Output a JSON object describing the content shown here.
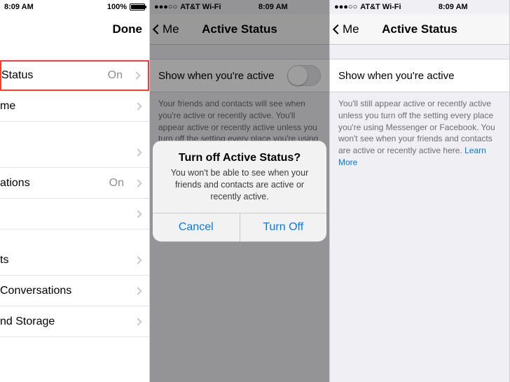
{
  "status": {
    "time": "8:09 AM",
    "carrier": "AT&T Wi-Fi",
    "battery_pct": "100%"
  },
  "panel1": {
    "done": "Done",
    "rows": [
      {
        "label": "Status",
        "value": "On"
      },
      {
        "label": "me",
        "value": ""
      },
      {
        "label": "",
        "value": ""
      },
      {
        "label": "ations",
        "value": "On"
      },
      {
        "label": "",
        "value": ""
      },
      {
        "label": "ts",
        "value": ""
      },
      {
        "label": "Conversations",
        "value": ""
      },
      {
        "label": "nd Storage",
        "value": ""
      }
    ]
  },
  "panel2": {
    "back": "Me",
    "title": "Active Status",
    "row_label": "Show when you're active",
    "desc": "Your friends and contacts will see when you're active or recently active. You'll appear active or recently active unless you turn off the setting every place you're using Messenger or Facebook. You'll also see when your friends and contacts are active or recently active.",
    "learn_more": "Learn More",
    "alert": {
      "title": "Turn off Active Status?",
      "msg": "You won't be able to see when your friends and contacts are active or recently active.",
      "cancel": "Cancel",
      "confirm": "Turn Off"
    }
  },
  "panel3": {
    "back": "Me",
    "title": "Active Status",
    "row_label": "Show when you're active",
    "desc": "You'll still appear active or recently active unless you turn off the setting every place you're using Messenger or Facebook. You won't see when your friends and contacts are active or recently active here.",
    "learn_more": "Learn More"
  }
}
